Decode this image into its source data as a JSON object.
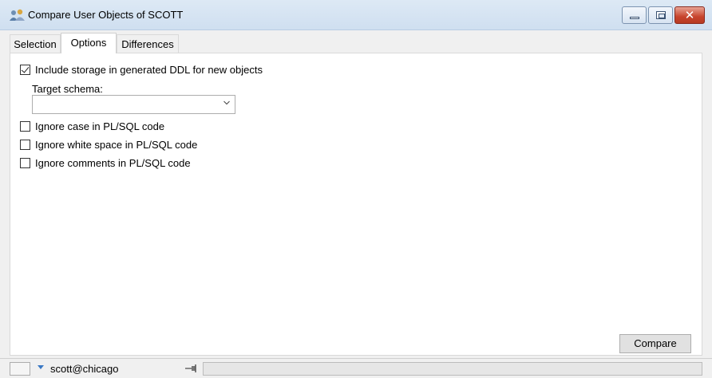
{
  "window": {
    "title": "Compare User Objects of SCOTT",
    "controls": {
      "minimize": "minimize",
      "maximize": "maximize",
      "close": "close"
    }
  },
  "tabs": [
    {
      "label": "Selection",
      "selected": false
    },
    {
      "label": "Options",
      "selected": true
    },
    {
      "label": "Differences",
      "selected": false
    }
  ],
  "options": {
    "include_storage": {
      "label": "Include storage in generated DDL for new objects",
      "checked": true
    },
    "target_schema": {
      "label": "Target schema:",
      "value": ""
    },
    "ignore_case": {
      "label": "Ignore case in PL/SQL code",
      "checked": false
    },
    "ignore_whitespace": {
      "label": "Ignore white space in PL/SQL code",
      "checked": false
    },
    "ignore_comments": {
      "label": "Ignore comments in PL/SQL code",
      "checked": false
    }
  },
  "actions": {
    "compare_label": "Compare"
  },
  "statusbar": {
    "connection": "scott@chicago",
    "progress": 0
  },
  "colors": {
    "title_bg": "#dde9f5",
    "close_button": "#c7442d",
    "accent_blue": "#3a78c4"
  }
}
